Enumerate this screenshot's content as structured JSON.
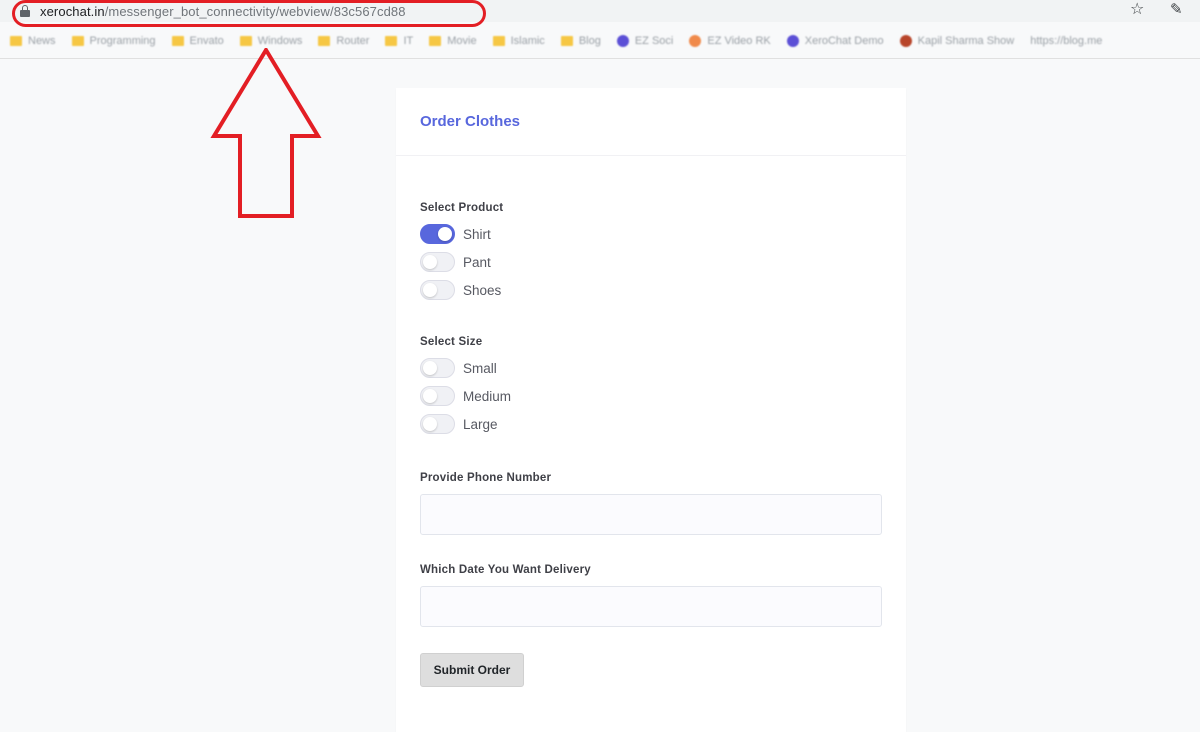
{
  "browser": {
    "url_host": "xerochat.in",
    "url_path": "/messenger_bot_connectivity/webview/83c567cd88",
    "bookmarks": [
      {
        "label": "News",
        "kind": "folder"
      },
      {
        "label": "Programming",
        "kind": "folder"
      },
      {
        "label": "Envato",
        "kind": "folder"
      },
      {
        "label": "Windows",
        "kind": "folder"
      },
      {
        "label": "Router",
        "kind": "folder"
      },
      {
        "label": "IT",
        "kind": "folder"
      },
      {
        "label": "Movie",
        "kind": "folder"
      },
      {
        "label": "Islamic",
        "kind": "folder"
      },
      {
        "label": "Blog",
        "kind": "folder"
      },
      {
        "label": "EZ Soci",
        "kind": "site",
        "color": "#5b4fd6"
      },
      {
        "label": "EZ Video RK",
        "kind": "site",
        "color": "#f08a4b"
      },
      {
        "label": "XeroChat Demo",
        "kind": "site",
        "color": "#5b4fd6"
      },
      {
        "label": "Kapil Sharma Show",
        "kind": "site",
        "color": "#b8452a"
      },
      {
        "label": "https://blog.me",
        "kind": "text"
      }
    ]
  },
  "form": {
    "title": "Order Clothes",
    "product": {
      "label": "Select Product",
      "options": [
        {
          "label": "Shirt",
          "checked": true
        },
        {
          "label": "Pant",
          "checked": false
        },
        {
          "label": "Shoes",
          "checked": false
        }
      ]
    },
    "size": {
      "label": "Select Size",
      "options": [
        {
          "label": "Small",
          "checked": false
        },
        {
          "label": "Medium",
          "checked": false
        },
        {
          "label": "Large",
          "checked": false
        }
      ]
    },
    "phone": {
      "label": "Provide Phone Number",
      "value": ""
    },
    "delivery": {
      "label": "Which Date You Want Delivery",
      "value": ""
    },
    "submit_label": "Submit Order"
  },
  "colors": {
    "accent": "#5867dd",
    "annotation": "#e31e24"
  }
}
